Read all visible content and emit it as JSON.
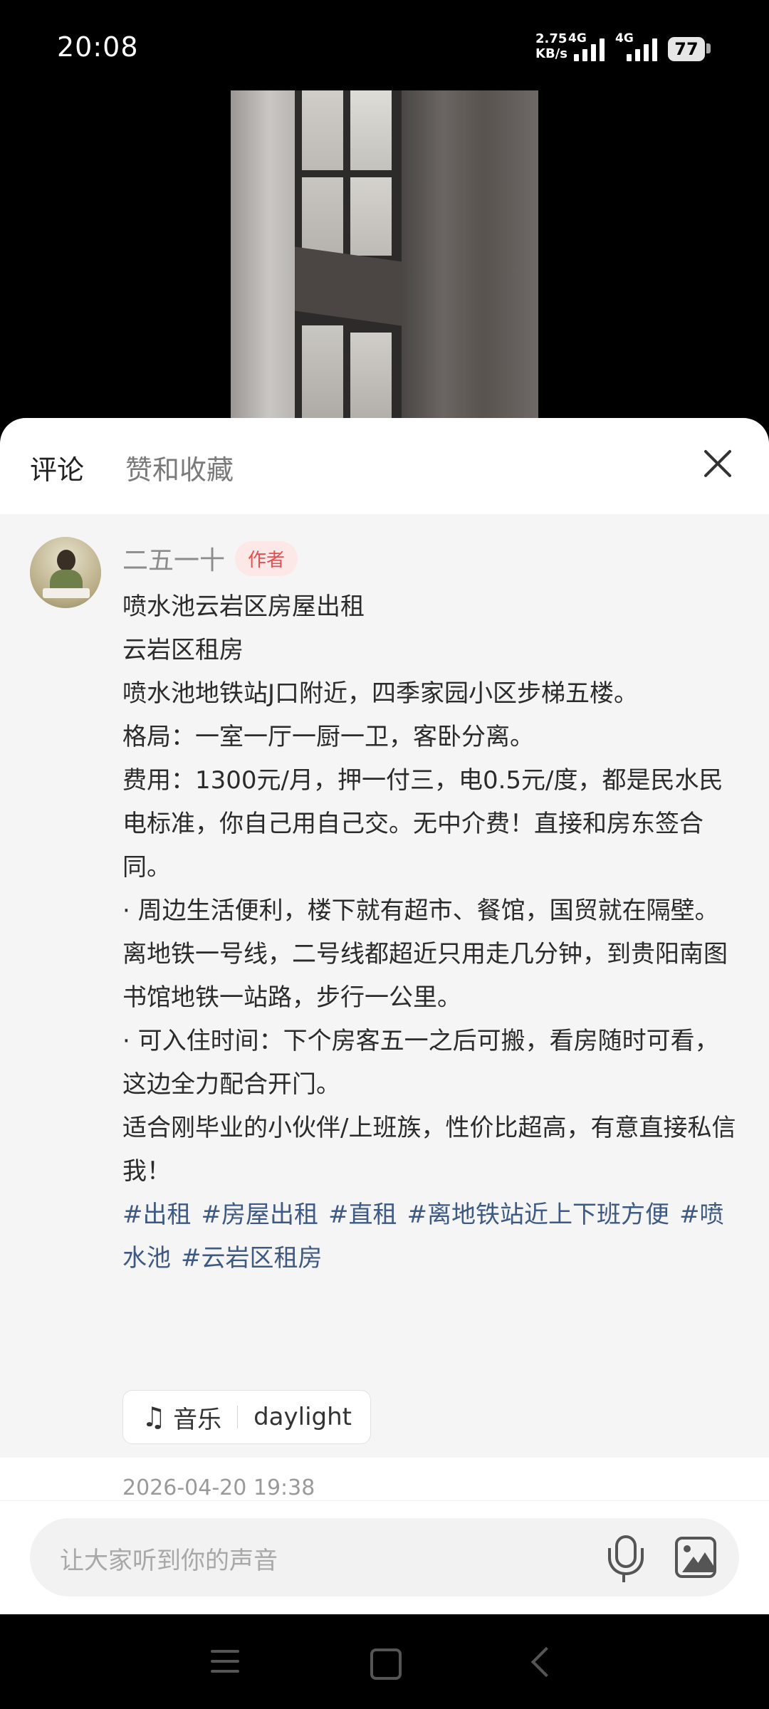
{
  "status_bar": {
    "time": "20:08",
    "speed_value": "2.75",
    "speed_unit": "KB/s",
    "network_1": "4G",
    "network_2": "4G",
    "battery": "77"
  },
  "sheet": {
    "tabs": {
      "comments": "评论",
      "likes_favorites": "赞和收藏"
    },
    "close_icon": "close-icon"
  },
  "post": {
    "author_name": "二五一十",
    "author_badge": "作者",
    "lines": [
      "喷水池云岩区房屋出租",
      "云岩区租房",
      "喷水池地铁站J口附近，四季家园小区步梯五楼。",
      "格局：一室一厅一厨一卫，客卧分离。",
      "费用：1300元/月，押一付三，电0.5元/度，都是民水民电标准，你自己用自己交。无中介费！直接和房东签合同。",
      "· 周边生活便利，楼下就有超市、餐馆，国贸就在隔壁。离地铁一号线，二号线都超近只用走几分钟，到贵阳南图书馆地铁一站路，步行一公里。",
      "· 可入住时间：下个房客五一之后可搬，看房随时可看，这边全力配合开门。",
      "适合刚毕业的小伙伴/上班族，性价比超高，有意直接私信我！"
    ],
    "tags": [
      "#出租",
      "#房屋出租",
      "#直租",
      "#离地铁站近上下班方便",
      "#喷水池",
      "#云岩区租房"
    ],
    "music": {
      "label": "音乐",
      "title": "daylight",
      "icon": "music-note-icon"
    },
    "date": "2026-04-20 19:38"
  },
  "input_bar": {
    "placeholder": "让大家听到你的声音",
    "mic_icon": "microphone-icon",
    "image_icon": "image-icon"
  }
}
